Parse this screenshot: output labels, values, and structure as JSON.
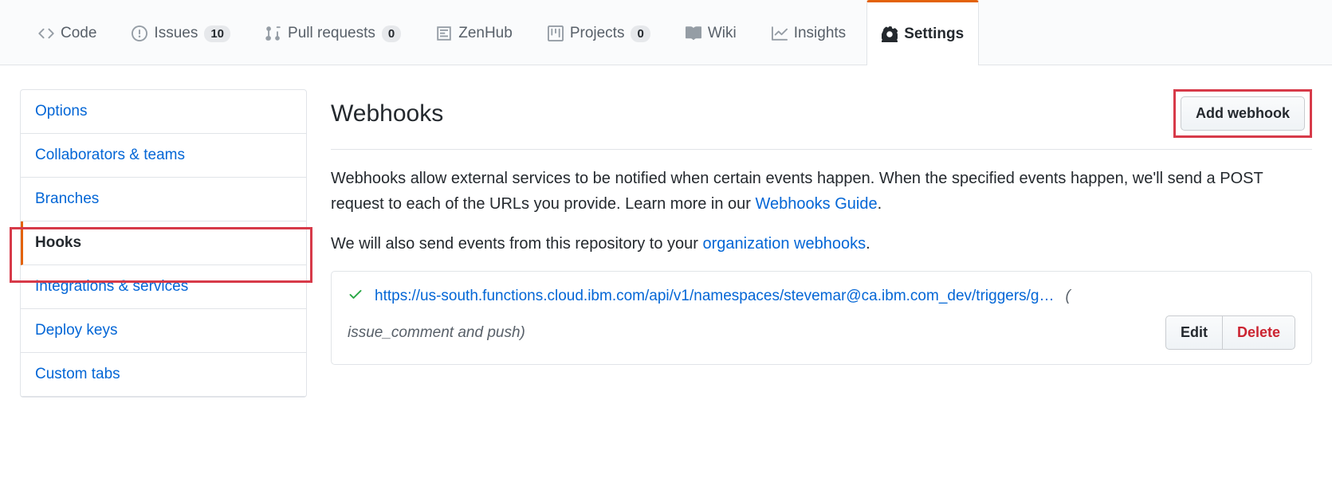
{
  "tabs": {
    "code": "Code",
    "issues": "Issues",
    "issues_count": "10",
    "pulls": "Pull requests",
    "pulls_count": "0",
    "zenhub": "ZenHub",
    "projects": "Projects",
    "projects_count": "0",
    "wiki": "Wiki",
    "insights": "Insights",
    "settings": "Settings"
  },
  "sidebar": {
    "options": "Options",
    "collaborators": "Collaborators & teams",
    "branches": "Branches",
    "hooks": "Hooks",
    "integrations": "Integrations & services",
    "deploy_keys": "Deploy keys",
    "custom_tabs": "Custom tabs"
  },
  "page": {
    "title": "Webhooks",
    "add_button": "Add webhook",
    "desc_1": "Webhooks allow external services to be notified when certain events happen. When the specified events happen, we'll send a POST request to each of the URLs you provide. Learn more in our ",
    "guide_link": "Webhooks Guide",
    "desc_2": "We will also send events from this repository to your ",
    "org_link": "organization webhooks"
  },
  "hook": {
    "url": "https://us-south.functions.cloud.ibm.com/api/v1/namespaces/stevemar@ca.ibm.com_dev/triggers/g…",
    "meta_open": "(",
    "meta": "issue_comment and push)",
    "edit": "Edit",
    "delete": "Delete"
  }
}
